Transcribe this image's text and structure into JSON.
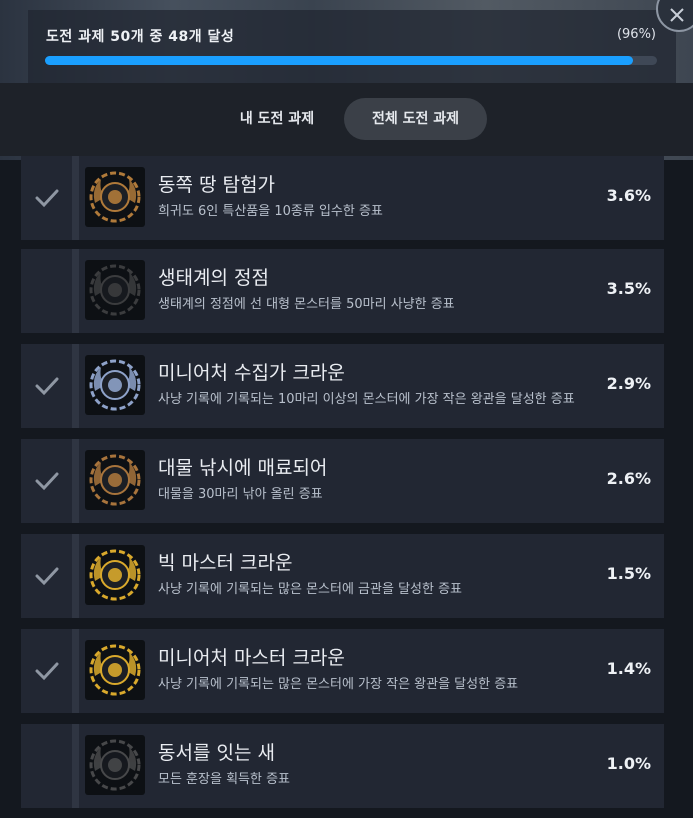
{
  "progress": {
    "text": "도전 과제 50개 중 48개 달성",
    "percent_label": "(96%)",
    "fraction": 0.96
  },
  "tabs": [
    {
      "label": "내 도전 과제",
      "selected": false
    },
    {
      "label": "전체 도전 과제",
      "selected": true
    }
  ],
  "colors": {
    "accent": "#1a9fff",
    "row_bg": "#222733",
    "tab_selected_bg": "#3b4048"
  },
  "achievements": [
    {
      "title": "동쪽 땅 탐험가",
      "desc": "희귀도 6인 특산품을 10종류 입수한 증표",
      "percent": "3.6%",
      "achieved": true,
      "icon": "treasure-map-badge-icon",
      "badge_color": "#b07a3a"
    },
    {
      "title": "생태계의 정점",
      "desc": "생태계의 정점에 선 대형 몬스터를 50마리 사냥한 증표",
      "percent": "3.5%",
      "achieved": false,
      "icon": "apex-monster-badge-icon",
      "badge_color": "#5a5a5a"
    },
    {
      "title": "미니어처 수집가 크라운",
      "desc": "사냥 기록에 기록되는 10마리 이상의 몬스터에 가장 작은 왕관을 달성한 증표",
      "percent": "2.9%",
      "achieved": true,
      "icon": "miniature-crown-collector-badge-icon",
      "badge_color": "#8ea2c9"
    },
    {
      "title": "대물 낚시에 매료되어",
      "desc": "대물을 30마리 낚아 올린 증표",
      "percent": "2.6%",
      "achieved": true,
      "icon": "big-fish-badge-icon",
      "badge_color": "#a8743c"
    },
    {
      "title": "빅 마스터 크라운",
      "desc": "사냥 기록에 기록되는 많은 몬스터에 금관을 달성한 증표",
      "percent": "1.5%",
      "achieved": true,
      "icon": "big-master-crown-badge-icon",
      "badge_color": "#d9a92c"
    },
    {
      "title": "미니어처 마스터 크라운",
      "desc": "사냥 기록에 기록되는 많은 몬스터에 가장 작은 왕관을 달성한 증표",
      "percent": "1.4%",
      "achieved": true,
      "icon": "miniature-master-crown-badge-icon",
      "badge_color": "#d9a92c"
    },
    {
      "title": "동서를 잇는 새",
      "desc": "모든 훈장을 획득한 증표",
      "percent": "1.0%",
      "achieved": false,
      "icon": "bird-emblem-badge-icon",
      "badge_color": "#6e6e6e"
    }
  ]
}
